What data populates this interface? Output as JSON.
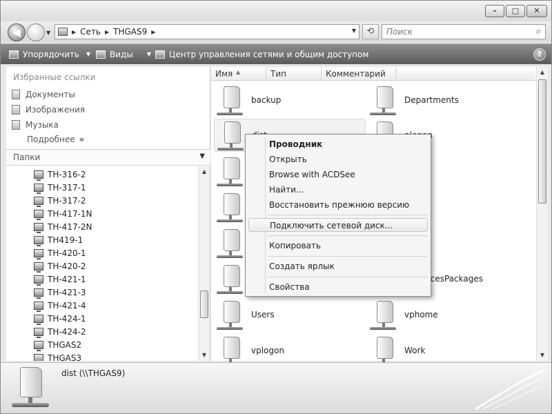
{
  "window": {
    "buttons": {
      "minimize": "–",
      "maximize": "□",
      "close": "✕"
    }
  },
  "address": {
    "path": [
      "Сеть",
      "THGAS9"
    ],
    "search_placeholder": "Поиск"
  },
  "toolbar": {
    "organize": "Упорядочить",
    "views": "Виды",
    "network_center": "Центр управления сетями и общим доступом",
    "help": "?"
  },
  "favorites": {
    "title": "Избранные ссылки",
    "items": [
      "Документы",
      "Изображения",
      "Музыка"
    ],
    "more": "Подробнее"
  },
  "folders": {
    "title": "Папки",
    "items": [
      "TH-316-2",
      "TH-317-1",
      "TH-317-2",
      "TH-417-1N",
      "TH-417-2N",
      "TH419-1",
      "TH-420-1",
      "TH-420-2",
      "TH-421-1",
      "TH-421-3",
      "TH-421-4",
      "TH-424-1",
      "TH-424-2",
      "THGAS2",
      "THGAS3"
    ]
  },
  "columns": [
    "Имя",
    "Тип",
    "Комментарий"
  ],
  "shares": {
    "left": [
      "backup",
      "dist",
      "",
      "",
      "",
      "",
      "Users",
      "vplogon"
    ],
    "right": [
      "Departments",
      "vplogon",
      "",
      "",
      "",
      "eServicesPackages",
      "vphome",
      "Work"
    ],
    "partial_left_dist": "dist",
    "partial_right_1": "plogon"
  },
  "context_menu": {
    "items": [
      "Проводник",
      "Открыть",
      "Browse with ACDSee",
      "Найти...",
      "Восстановить прежнюю версию",
      "Подключить сетевой диск...",
      "Копировать",
      "Создать ярлык",
      "Свойства"
    ]
  },
  "details": {
    "name": "dist (\\\\THGAS9)"
  },
  "icons": {
    "back": "back-arrow-icon",
    "forward": "forward-arrow-icon",
    "refresh": "refresh-icon",
    "search": "search-icon",
    "share": "network-share-icon",
    "computer": "computer-icon"
  }
}
